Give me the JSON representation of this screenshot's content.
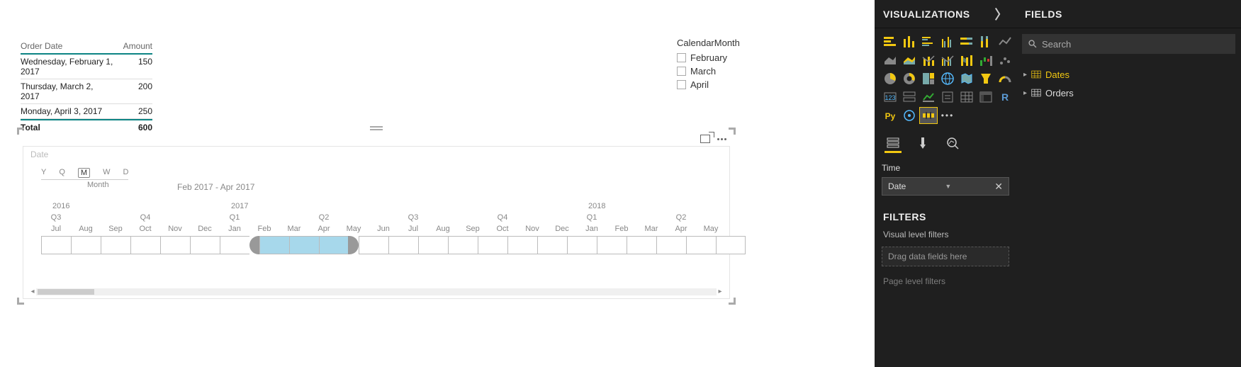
{
  "table": {
    "col1": "Order Date",
    "col2": "Amount",
    "rows": [
      {
        "date": "Wednesday, February 1, 2017",
        "amt": "150"
      },
      {
        "date": "Thursday, March 2, 2017",
        "amt": "200"
      },
      {
        "date": "Monday, April 3, 2017",
        "amt": "250"
      }
    ],
    "total_label": "Total",
    "total_value": "600"
  },
  "slicer": {
    "title": "CalendarMonth",
    "items": [
      "February",
      "March",
      "April"
    ]
  },
  "timeline": {
    "title": "Date",
    "granularity": [
      "Y",
      "Q",
      "M",
      "W",
      "D"
    ],
    "granularity_selected": "M",
    "granularity_label": "Month",
    "range_text": "Feb 2017 - Apr 2017",
    "years": [
      {
        "label": "2016",
        "pos": 16
      },
      {
        "label": "2017",
        "pos": 268
      },
      {
        "label": "2018",
        "pos": 772
      }
    ],
    "quarters": [
      {
        "label": "Q3",
        "pos": 0
      },
      {
        "label": "Q4",
        "pos": 126
      },
      {
        "label": "Q1",
        "pos": 252
      },
      {
        "label": "Q2",
        "pos": 378
      },
      {
        "label": "Q3",
        "pos": 504
      },
      {
        "label": "Q4",
        "pos": 630
      },
      {
        "label": "Q1",
        "pos": 756
      },
      {
        "label": "Q2",
        "pos": 882
      }
    ],
    "months": [
      "Jul",
      "Aug",
      "Sep",
      "Oct",
      "Nov",
      "Dec",
      "Jan",
      "Feb",
      "Mar",
      "Apr",
      "May",
      "Jun",
      "Jul",
      "Aug",
      "Sep",
      "Oct",
      "Nov",
      "Dec",
      "Jan",
      "Feb",
      "Mar",
      "Apr",
      "May"
    ],
    "selected_start": 7,
    "selected_end": 9
  },
  "viz_pane": {
    "title": "VISUALIZATIONS",
    "field_well_title": "Time",
    "field_well_value": "Date",
    "filters_title": "FILTERS",
    "vlf_title": "Visual level filters",
    "vlf_placeholder": "Drag data fields here",
    "plf_title": "Page level filters"
  },
  "fields_pane": {
    "title": "FIELDS",
    "search_placeholder": "Search",
    "tables": [
      {
        "name": "Dates",
        "active": true
      },
      {
        "name": "Orders",
        "active": false
      }
    ]
  }
}
